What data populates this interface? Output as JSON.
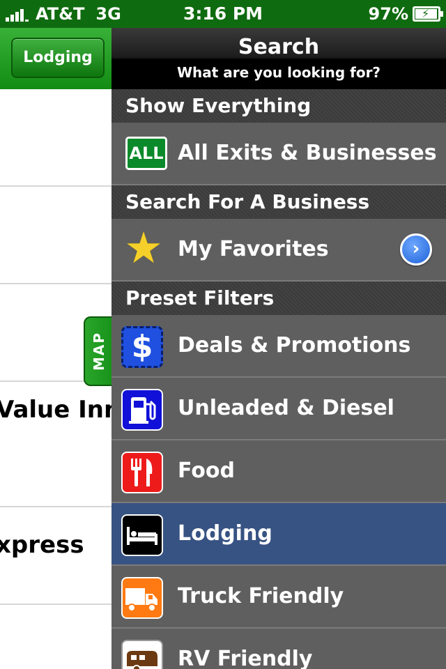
{
  "status_bar": {
    "carrier": "AT&T",
    "network": "3G",
    "time": "3:16 PM",
    "battery": "97%",
    "battery_level": 0.97
  },
  "left_pane": {
    "nav_button": "Lodging",
    "partial_items": [
      "Value Inn",
      "xpress"
    ],
    "map_tab": "MAP"
  },
  "panel": {
    "title": "Search",
    "subtitle": "What are you looking for?",
    "sections": {
      "show_everything": "Show Everything",
      "search_business": "Search For A Business",
      "preset_filters": "Preset Filters"
    },
    "rows": {
      "all_exits": {
        "label": "All Exits & Businesses",
        "icon": "all-icon",
        "icon_text": "ALL"
      },
      "favorites": {
        "label": "My Favorites",
        "icon": "star-icon"
      },
      "deals": {
        "label": "Deals & Promotions",
        "icon": "dollar-icon",
        "icon_text": "$"
      },
      "fuel": {
        "label": "Unleaded & Diesel",
        "icon": "fuel-pump-icon"
      },
      "food": {
        "label": "Food",
        "icon": "fork-knife-icon"
      },
      "lodging": {
        "label": "Lodging",
        "icon": "bed-icon",
        "selected": true
      },
      "truck": {
        "label": "Truck Friendly",
        "icon": "truck-icon"
      },
      "rv": {
        "label": "RV Friendly",
        "icon": "rv-icon"
      }
    }
  },
  "colors": {
    "status_green": "#0f6b0f",
    "panel_gray": "#5f5f5f",
    "section_dark": "#3b3b3b",
    "selected_blue": "#375383",
    "accent_blue": "#1d62d6"
  }
}
